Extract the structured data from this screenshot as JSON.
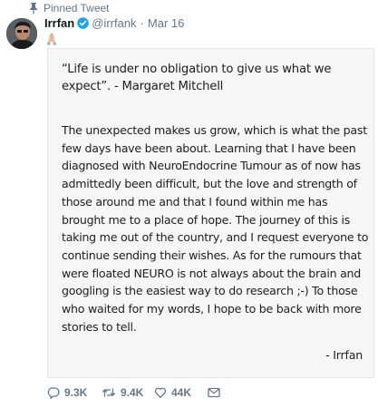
{
  "pinned_label": "Pinned Tweet",
  "author": {
    "name": "Irrfan",
    "handle": "@irrfank",
    "separator": "·",
    "date": "Mar 16"
  },
  "icons": {
    "pin": "pushpin-icon",
    "verified": "verified-badge-icon",
    "emoji": "folded-hands-emoji",
    "reply": "reply-icon",
    "retweet": "retweet-icon",
    "like": "heart-icon",
    "dm": "envelope-icon"
  },
  "colors": {
    "secondary_text": "#657786",
    "verified_blue": "#1da1f2",
    "card_background": "#f6f6f6"
  },
  "card": {
    "quote": "“Life is under no obligation to give us what we expect”. - Margaret Mitchell",
    "body": "The unexpected makes us grow, which is what the past few days have been about. Learning that I have been diagnosed with NeuroEndocrine Tumour as of now has admittedly been difficult, but the love and strength of those around me and that I found within me has brought me to a place of hope. The journey of this is taking me out of the country, and I request everyone to continue sending their wishes. As for the rumours that were floated NEURO is not always about the brain and googling is the easiest way to do research ;-) To those who waited for my words, I hope to be back with more stories to tell.",
    "signature": "- Irrfan"
  },
  "actions": {
    "replies": "9.3K",
    "retweets": "9.4K",
    "likes": "44K"
  }
}
